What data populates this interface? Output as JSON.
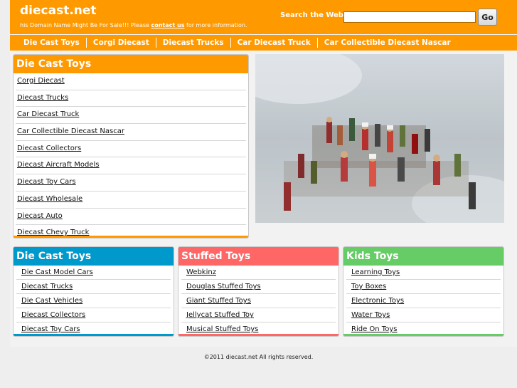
{
  "header": {
    "site_name": "diecast.net",
    "tagline_prefix": "his Domain Name Might Be For Sale!!! Please",
    "tagline_link": "contact us",
    "tagline_suffix": "for more information.",
    "search_label": "Search the Web:",
    "search_value": "",
    "search_button": "Go"
  },
  "nav": [
    "Die Cast Toys",
    "Corgi Diecast",
    "Diecast Trucks",
    "Car Diecast Truck",
    "Car Collectible Diecast Nascar"
  ],
  "main_box": {
    "title": "Die Cast Toys",
    "items": [
      "Corgi Diecast",
      "Diecast Trucks",
      "Car Diecast Truck",
      "Car Collectible Diecast Nascar",
      "Diecast Collectors",
      "Diecast Aircraft Models",
      "Diecast Toy Cars",
      "Diecast Wholesale",
      "Diecast Auto",
      "Diecast Chevy Truck"
    ]
  },
  "boxes": [
    {
      "title": "Die Cast Toys",
      "color": "#0099cc",
      "items": [
        "Die Cast Model Cars",
        "Diecast Trucks",
        "Die Cast Vehicles",
        "Diecast Collectors",
        "Diecast Toy Cars"
      ]
    },
    {
      "title": "Stuffed Toys",
      "color": "#ff6666",
      "items": [
        "Webkinz",
        "Douglas Stuffed Toys",
        "Giant Stuffed Toys",
        "Jellycat Stuffed Toy",
        "Musical Stuffed Toys"
      ]
    },
    {
      "title": "Kids Toys",
      "color": "#66cc66",
      "items": [
        "Learning Toys",
        "Toy Boxes",
        "Electronic Toys",
        "Water Toys",
        "Ride On Toys"
      ]
    }
  ],
  "colors": {
    "accent": "#ff9900",
    "blue": "#0099cc",
    "red": "#ff6666",
    "green": "#66cc66"
  },
  "photo_icon": "toy-soldiers-photo",
  "footer": "©2011 diecast.net All rights reserved."
}
